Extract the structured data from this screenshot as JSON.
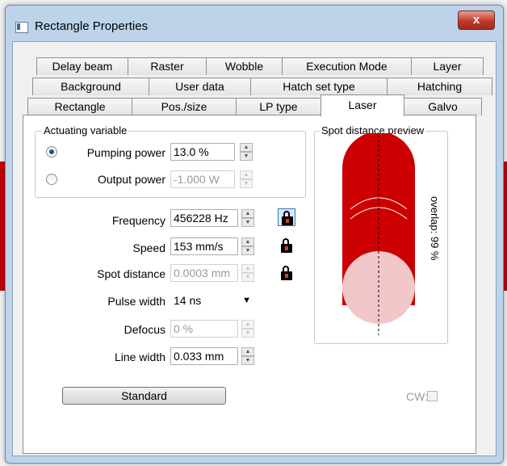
{
  "window": {
    "title": "Rectangle Properties",
    "close_label": "x"
  },
  "tabs": {
    "row1": [
      "Delay beam",
      "Raster",
      "Wobble",
      "Execution Mode",
      "Layer"
    ],
    "row2": [
      "Background",
      "User data",
      "Hatch set type",
      "Hatching"
    ],
    "row3": [
      "Rectangle",
      "Pos./size",
      "LP type",
      "Laser",
      "Galvo"
    ],
    "active": "Laser"
  },
  "actuating": {
    "legend": "Actuating variable",
    "pumping": {
      "label": "Pumping power",
      "value": "13.0 %",
      "selected": true
    },
    "output": {
      "label": "Output power",
      "value": "-1.000 W",
      "selected": false
    }
  },
  "params": {
    "frequency": {
      "label": "Frequency",
      "value": "456228 Hz"
    },
    "speed": {
      "label": "Speed",
      "value": "153 mm/s"
    },
    "spot_distance": {
      "label": "Spot distance",
      "value": "0.0003 mm"
    },
    "pulse_width": {
      "label": "Pulse width",
      "value": "14 ns"
    },
    "defocus": {
      "label": "Defocus",
      "value": "0 %"
    },
    "line_width": {
      "label": "Line width",
      "value": "0.033 mm"
    }
  },
  "standard_button": "Standard",
  "cw": {
    "label": "CW:",
    "checked": false
  },
  "preview": {
    "legend": "Spot distance preview",
    "overlap_label": "overlap: 99 %",
    "colors": {
      "spot": "#cc0000",
      "last_spot": "#f2c7c9"
    }
  },
  "icons": {
    "app": "window-icon",
    "lock": "lock-icon",
    "spin": "spinner-icon",
    "dropdown": "chevron-down-icon"
  }
}
